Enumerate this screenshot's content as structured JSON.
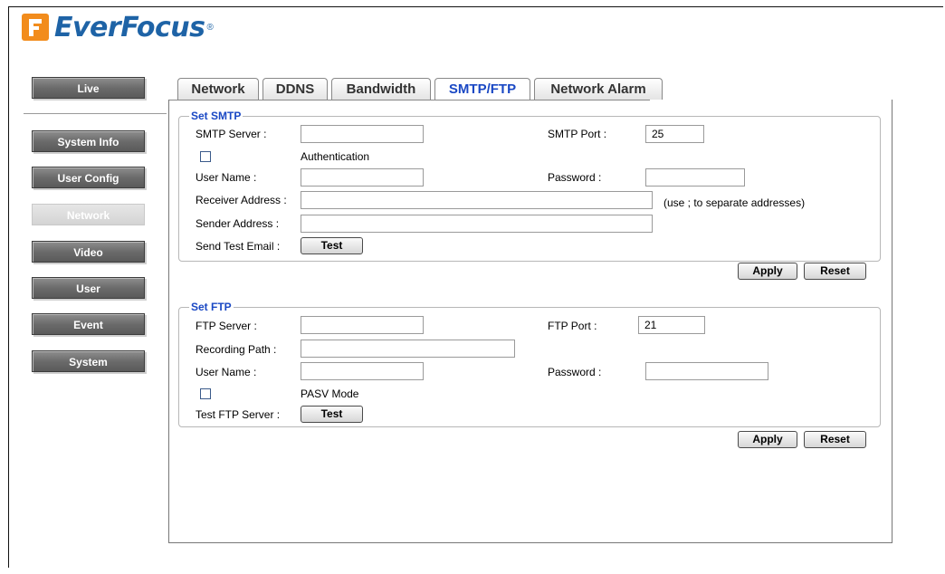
{
  "brand": {
    "name": "EverFocus",
    "reg": "®",
    "color": "#1e63a6",
    "mark_color": "#f28c1c"
  },
  "nav": {
    "items": [
      {
        "label": "Live",
        "active": false
      },
      {
        "label": "System Info",
        "active": false
      },
      {
        "label": "User Config",
        "active": false
      },
      {
        "label": "Network",
        "active": true
      },
      {
        "label": "Video",
        "active": false
      },
      {
        "label": "User",
        "active": false
      },
      {
        "label": "Event",
        "active": false
      },
      {
        "label": "System",
        "active": false
      }
    ]
  },
  "tabs": [
    {
      "label": "Network",
      "selected": false
    },
    {
      "label": "DDNS",
      "selected": false
    },
    {
      "label": "Bandwidth",
      "selected": false
    },
    {
      "label": "SMTP/FTP",
      "selected": true
    },
    {
      "label": "Network Alarm",
      "selected": false
    }
  ],
  "smtp": {
    "legend": "Set SMTP",
    "server_label": "SMTP Server :",
    "server_value": "",
    "port_label": "SMTP Port :",
    "port_value": "25",
    "auth_label": "Authentication",
    "auth_checked": false,
    "username_label": "User Name :",
    "username_value": "",
    "password_label": "Password :",
    "password_value": "",
    "receiver_label": "Receiver Address :",
    "receiver_value": "",
    "receiver_hint": "(use ; to separate addresses)",
    "sender_label": "Sender Address :",
    "sender_value": "",
    "test_label": "Send Test Email :",
    "test_button": "Test",
    "apply_button": "Apply",
    "reset_button": "Reset"
  },
  "ftp": {
    "legend": "Set FTP",
    "server_label": "FTP Server :",
    "server_value": "",
    "port_label": "FTP Port :",
    "port_value": "21",
    "path_label": "Recording Path :",
    "path_value": "",
    "username_label": "User Name :",
    "username_value": "",
    "password_label": "Password :",
    "password_value": "",
    "pasv_label": "PASV Mode",
    "pasv_checked": false,
    "test_label": "Test FTP Server :",
    "test_button": "Test",
    "apply_button": "Apply",
    "reset_button": "Reset"
  },
  "colors": {
    "accent": "#1a48c4",
    "nav_bg": "#6b6b6b",
    "nav_active_bg": "#d9d9d9"
  }
}
